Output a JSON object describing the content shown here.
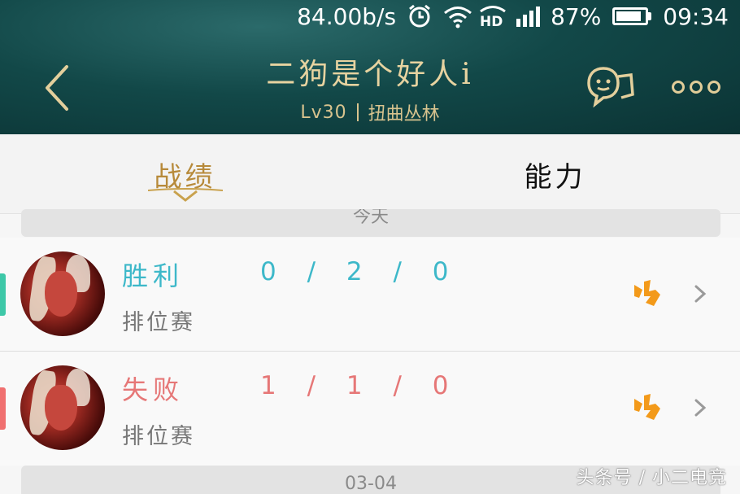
{
  "status_bar": {
    "net_speed": "84.00b/s",
    "battery_percent": "87%",
    "battery_level": 0.87,
    "time": "09:34",
    "icons": [
      "alarm-icon",
      "wifi-icon",
      "hd-icon",
      "signal-icon",
      "battery-icon"
    ]
  },
  "header": {
    "player_name": "二狗是个好人i",
    "level": "Lv30",
    "map": "扭曲丛林",
    "icons": [
      "back-icon",
      "chat-icon",
      "more-icon"
    ]
  },
  "tabs": [
    {
      "label": "战绩",
      "active": true
    },
    {
      "label": "能力",
      "active": false
    }
  ],
  "top_date_label": "今天",
  "matches": [
    {
      "result": "胜利",
      "mode": "排位赛",
      "kda": "0 / 2 / 0",
      "result_color": "#3db8c9",
      "side_color": "#3ec8a8"
    },
    {
      "result": "失败",
      "mode": "排位赛",
      "kda": "1 / 1 / 0",
      "result_color": "#e67777",
      "side_color": "#f07070"
    }
  ],
  "bottom_date_label": "03-04",
  "watermark": "头条号 / 小二电竞",
  "colors": {
    "accent_gold": "#e7d3a0",
    "badge_orange": "#f39a1a"
  }
}
